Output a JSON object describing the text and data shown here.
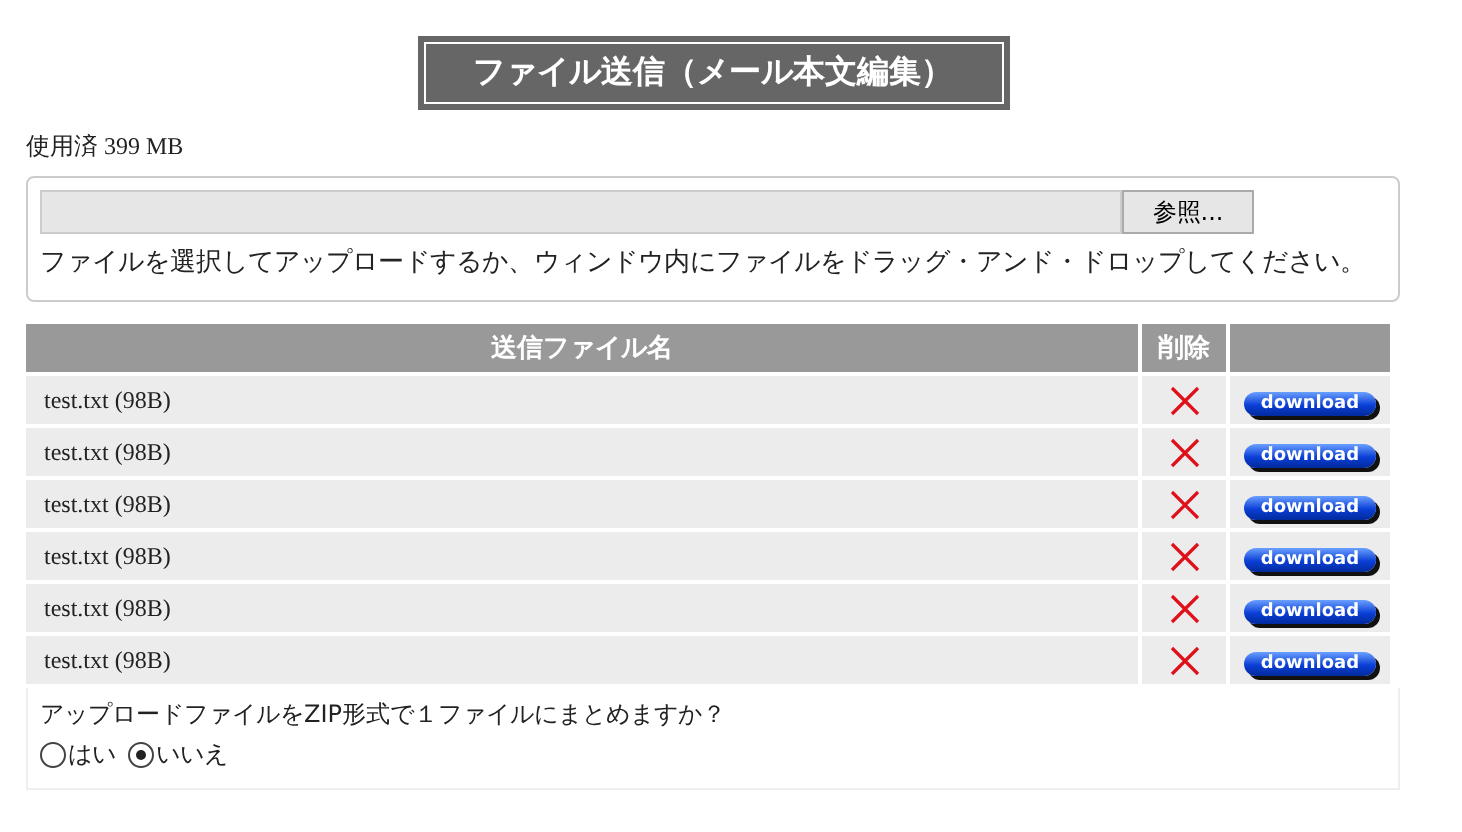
{
  "title": "ファイル送信（メール本文編集）",
  "usage": "使用済 399 MB",
  "upload": {
    "browse_button": "参照...",
    "hint": "ファイルを選択してアップロードするか、ウィンドウ内にファイルをドラッグ・アンド・ドロップしてください。"
  },
  "table": {
    "columns": [
      "送信ファイル名",
      "削除"
    ],
    "rows": [
      {
        "file": "test.txt (98B)",
        "download": "download"
      },
      {
        "file": "test.txt (98B)",
        "download": "download"
      },
      {
        "file": "test.txt (98B)",
        "download": "download"
      },
      {
        "file": "test.txt (98B)",
        "download": "download"
      },
      {
        "file": "test.txt (98B)",
        "download": "download"
      },
      {
        "file": "test.txt (98B)",
        "download": "download"
      }
    ]
  },
  "zip": {
    "question": "アップロードファイルをZIP形式で１ファイルにまとめますか？",
    "options": [
      {
        "label": "はい",
        "selected": false
      },
      {
        "label": "いいえ",
        "selected": true
      }
    ]
  }
}
